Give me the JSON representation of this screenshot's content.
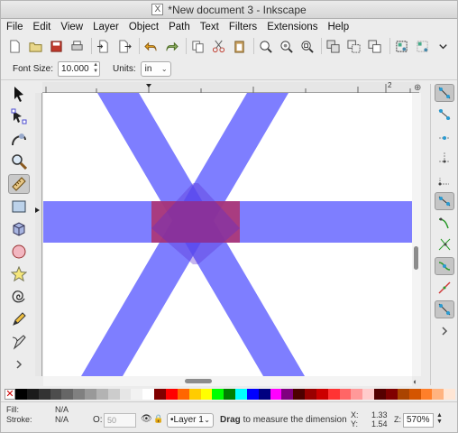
{
  "window": {
    "title": "*New document 3 - Inkscape",
    "app_icon": "inkscape-x-icon"
  },
  "menu": [
    "File",
    "Edit",
    "View",
    "Layer",
    "Object",
    "Path",
    "Text",
    "Filters",
    "Extensions",
    "Help"
  ],
  "commands": [
    "new-document-icon",
    "open-icon",
    "save-icon",
    "print-icon",
    "import-icon",
    "export-icon",
    "undo-icon",
    "redo-icon",
    "copy-icon",
    "cut-icon",
    "paste-icon",
    "zoom-selection-icon",
    "zoom-drawing-icon",
    "zoom-page-icon",
    "duplicate-icon",
    "clone-icon",
    "unlink-clone-icon",
    "group-icon",
    "ungroup-icon",
    "more-chevron-icon"
  ],
  "controls": {
    "font_size_label": "Font Size:",
    "font_size_value": "10.000",
    "units_label": "Units:",
    "units_value": "in"
  },
  "tools": [
    "selector-tool",
    "node-tool",
    "tweak-tool",
    "zoom-tool",
    "measure-tool",
    "rectangle-tool",
    "box-3d-tool",
    "ellipse-tool",
    "star-tool",
    "spiral-tool",
    "pencil-tool",
    "pen-tool"
  ],
  "active_tool": "measure-tool",
  "ruler": {
    "marker": "2"
  },
  "canvas": {
    "shape_color": "#5a5aff",
    "overlap_color": "#b0306a"
  },
  "snap_controls": [
    "snap-toggle",
    "snap-bbox",
    "snap-bbox-edge",
    "snap-bbox-corner",
    "snap-bbox-midpoint",
    "snap-nodes",
    "snap-paths",
    "snap-path-intersection",
    "snap-cusp-nodes",
    "snap-smooth-nodes",
    "snap-others"
  ],
  "palette": [
    "#000000",
    "#1a1a1a",
    "#333333",
    "#4d4d4d",
    "#666666",
    "#808080",
    "#999999",
    "#b3b3b3",
    "#cccccc",
    "#e6e6e6",
    "#f2f2f2",
    "#ffffff",
    "#800000",
    "#ff0000",
    "#ff6600",
    "#ffcc00",
    "#ffff00",
    "#00ff00",
    "#008000",
    "#00ffff",
    "#0000ff",
    "#000080",
    "#ff00ff",
    "#800080",
    "#4d0000",
    "#990000",
    "#cc0000",
    "#ff3333",
    "#ff6666",
    "#ff9999",
    "#ffcccc",
    "#550000",
    "#800000",
    "#aa4400",
    "#d45500",
    "#ff7f2a",
    "#ffb380",
    "#ffe6d5"
  ],
  "status": {
    "fill_label": "Fill:",
    "fill_value": "N/A",
    "stroke_label": "Stroke:",
    "stroke_value": "N/A",
    "opacity_label": "O:",
    "opacity_value": "50",
    "layer": "•Layer 1",
    "message_bold": "Drag",
    "message_rest": " to measure the dimension",
    "x_label": "X:",
    "x_value": "1.33",
    "y_label": "Y:",
    "y_value": "1.54",
    "zoom_label": "Z:",
    "zoom_value": "570%"
  }
}
